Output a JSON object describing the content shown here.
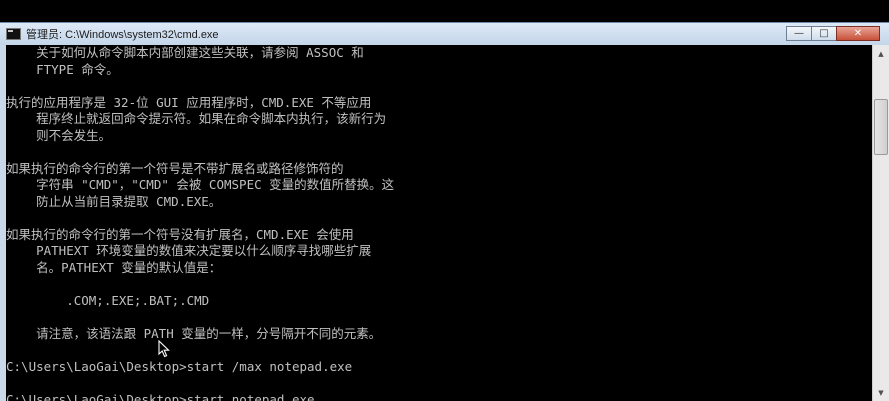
{
  "window": {
    "title": "管理员: C:\\Windows\\system32\\cmd.exe",
    "controls": {
      "minimize": "—",
      "maximize": "□",
      "close": "✕"
    }
  },
  "console": {
    "lines": [
      "    关于如何从命令脚本内部创建这些关联，请参阅 ASSOC 和",
      "    FTYPE 命令。",
      "",
      "执行的应用程序是 32-位 GUI 应用程序时，CMD.EXE 不等应用",
      "    程序终止就返回命令提示符。如果在命令脚本内执行，该新行为",
      "    则不会发生。",
      "",
      "如果执行的命令行的第一个符号是不带扩展名或路径修饰符的",
      "    字符串 \"CMD\"，\"CMD\" 会被 COMSPEC 变量的数值所替换。这",
      "    防止从当前目录提取 CMD.EXE。",
      "",
      "如果执行的命令行的第一个符号没有扩展名，CMD.EXE 会使用",
      "    PATHEXT 环境变量的数值来决定要以什么顺序寻找哪些扩展",
      "    名。PATHEXT 变量的默认值是：",
      "",
      "        .COM;.EXE;.BAT;.CMD",
      "",
      "    请注意，该语法跟 PATH 变量的一样，分号隔开不同的元素。",
      "",
      "C:\\Users\\LaoGai\\Desktop>start /max notepad.exe",
      "",
      "C:\\Users\\LaoGai\\Desktop>start notepad.exe"
    ]
  },
  "icons": {
    "app": "cmd-icon",
    "scroll_up": "arrow-up-icon",
    "scroll_down": "arrow-down-icon",
    "cursor": "mouse-pointer-icon"
  },
  "colors": {
    "console_bg": "#000000",
    "console_text": "#c0c0c0",
    "titlebar": "#c9d9ea",
    "close_button": "#c7503a"
  }
}
